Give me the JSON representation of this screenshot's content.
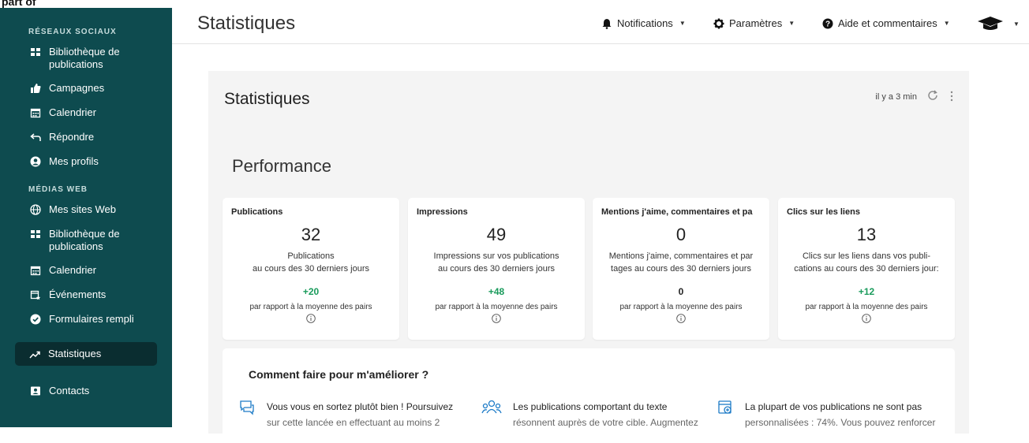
{
  "cropped_text": "part of",
  "sidebar": {
    "section_social": "RÉSEAUX SOCIAUX",
    "social_items": [
      {
        "label_line1": "Bibliothèque de",
        "label_line2": "publications",
        "icon": "grid-icon"
      },
      {
        "label": "Campagnes",
        "icon": "thumbs-up-icon"
      },
      {
        "label": "Calendrier",
        "icon": "calendar-icon"
      },
      {
        "label": "Répondre",
        "icon": "reply-icon"
      },
      {
        "label": "Mes profils",
        "icon": "user-circle-icon"
      }
    ],
    "section_web": "MÉDIAS WEB",
    "web_items": [
      {
        "label": "Mes sites Web",
        "icon": "globe-icon"
      },
      {
        "label_line1": "Bibliothèque de",
        "label_line2": "publications",
        "icon": "grid-icon"
      },
      {
        "label": "Calendrier",
        "icon": "calendar-icon"
      },
      {
        "label": "Événements",
        "icon": "calendar-star-icon"
      },
      {
        "label": "Formulaires rempli",
        "icon": "check-circle-icon"
      }
    ],
    "active_item": {
      "label": "Statistiques",
      "icon": "trend-icon"
    },
    "contacts": {
      "label": "Contacts",
      "icon": "contact-card-icon"
    }
  },
  "header": {
    "title": "Statistiques",
    "notifications": "Notifications",
    "settings": "Paramètres",
    "help": "Aide et commentaires"
  },
  "panel": {
    "title": "Statistiques",
    "updated": "il y a 3 min",
    "section": "Performance",
    "cards": [
      {
        "head": "Publications",
        "value": "32",
        "desc1": "Publications",
        "desc2": "au cours des 30 derniers jours",
        "delta": "+20",
        "peer": "par rapport à la moyenne des pairs"
      },
      {
        "head": "Impressions",
        "value": "49",
        "desc1": "Impressions sur vos publications",
        "desc2": "au cours des 30 derniers jours",
        "delta": "+48",
        "peer": "par rapport à la moyenne des pairs"
      },
      {
        "head": "Mentions j'aime, commentaires et pa",
        "value": "0",
        "desc1": "Mentions j'aime, commentaires et par",
        "desc2": "tages au cours des 30 derniers jours",
        "delta": "0",
        "peer": "par rapport à la moyenne des pairs"
      },
      {
        "head": "Clics sur les liens",
        "value": "13",
        "desc1": "Clics sur les liens dans vos publi-",
        "desc2": "cations au cours des 30 derniers jour:",
        "delta": "+12",
        "peer": "par rapport à la moyenne des pairs"
      }
    ],
    "improve": {
      "title": "Comment faire pour m'améliorer ?",
      "tips": [
        {
          "line1": "Vous vous en sortez plutôt bien ! Poursuivez",
          "line2": "sur cette lancée en effectuant au moins 2",
          "icon": "chat-bubbles-icon"
        },
        {
          "line1": "Les publications comportant du texte",
          "line2": "résonnent auprès de votre cible. Augmentez",
          "icon": "users-icon"
        },
        {
          "line1": "La plupart de vos publications ne sont pas",
          "line2": "personnalisées : 74%. Vous pouvez renforcer",
          "icon": "calendar-add-icon"
        }
      ]
    }
  },
  "colors": {
    "sidebar": "#0e4b4f",
    "active": "#0a2d30",
    "positive": "#1a9b5c",
    "panel": "#f4f4f4"
  }
}
